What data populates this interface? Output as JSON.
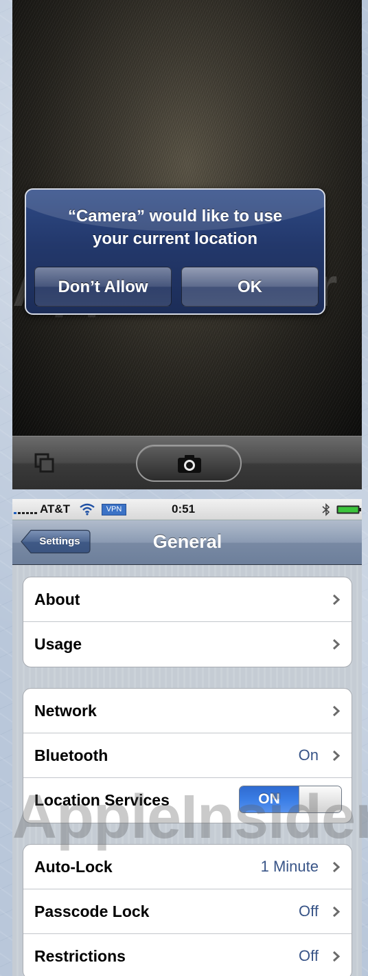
{
  "camera": {
    "alert": {
      "message_line1": "“Camera” would like to use",
      "message_line2": "your current location",
      "dont_allow_label": "Don’t Allow",
      "ok_label": "OK"
    },
    "toolbar": {
      "gallery_icon": "camera-roll-icon",
      "shutter_icon": "camera-icon"
    }
  },
  "watermark": {
    "text": "AppleInsider"
  },
  "settings": {
    "status_bar": {
      "carrier": "AT&T",
      "vpn": "VPN",
      "time": "0:51",
      "icons": [
        "signal-icon",
        "wifi-icon",
        "bluetooth-icon",
        "battery-icon"
      ]
    },
    "nav": {
      "back_label": "Settings",
      "title": "General"
    },
    "groups": [
      {
        "rows": [
          {
            "label": "About",
            "value": "",
            "accessory": "chevron"
          },
          {
            "label": "Usage",
            "value": "",
            "accessory": "chevron"
          }
        ]
      },
      {
        "rows": [
          {
            "label": "Network",
            "value": "",
            "accessory": "chevron"
          },
          {
            "label": "Bluetooth",
            "value": "On",
            "accessory": "chevron"
          },
          {
            "label": "Location Services",
            "toggle": "ON",
            "accessory": "switch"
          }
        ]
      },
      {
        "rows": [
          {
            "label": "Auto-Lock",
            "value": "1 Minute",
            "accessory": "chevron"
          },
          {
            "label": "Passcode Lock",
            "value": "Off",
            "accessory": "chevron"
          },
          {
            "label": "Restrictions",
            "value": "Off",
            "accessory": "chevron"
          }
        ]
      }
    ],
    "colors": {
      "row_value": "#385487",
      "toggle_on": "#3b7ee6",
      "nav_bar": "#8b9bb3"
    }
  }
}
